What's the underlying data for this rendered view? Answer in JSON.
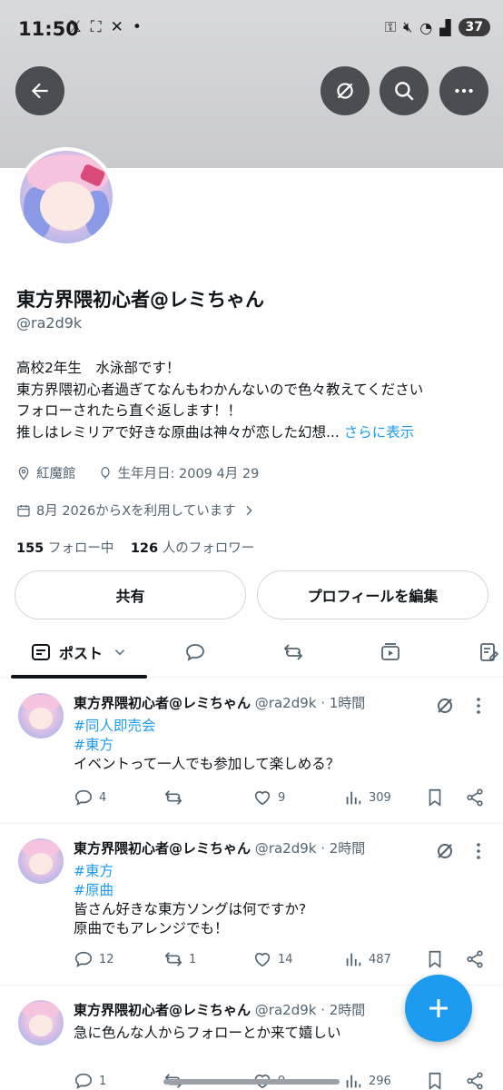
{
  "status_bar": {
    "time": "11:50",
    "battery": "37"
  },
  "profile": {
    "name": "東方界隈初心者@レミちゃん",
    "handle": "@ra2d9k",
    "bio_lines": [
      "高校2年生　水泳部です！",
      "東方界隈初心者過ぎてなんもわかんないので色々教えてください",
      "フォローされたら直ぐ返します！！",
      "推しはレミリアで好きな原曲は神々が恋した幻想..."
    ],
    "bio_more": "さらに表示",
    "location": "紅魔館",
    "birthday": "生年月日: 2009 4月 29",
    "joined": "8月 2026からXを利用しています",
    "following_count": "155",
    "following_label": "フォロー中",
    "followers_count": "126",
    "followers_label": "人のフォロワー",
    "share_button": "共有",
    "edit_button": "プロフィールを編集"
  },
  "tabs": {
    "posts_label": "ポスト"
  },
  "posts": [
    {
      "name": "東方界隈初心者@レミちゃん",
      "meta": "@ra2d9k · 1時間",
      "tags": [
        "#同人即売会",
        "#東方"
      ],
      "text_lines": [
        "イベントって一人でも参加して楽しめる？"
      ],
      "replies": "4",
      "reposts": "",
      "likes": "9",
      "views": "309"
    },
    {
      "name": "東方界隈初心者@レミちゃん",
      "meta": "@ra2d9k · 2時間",
      "tags": [
        "#東方",
        "#原曲"
      ],
      "text_lines": [
        "皆さん好きな東方ソングは何ですか?",
        "原曲でもアレンジでも！"
      ],
      "replies": "12",
      "reposts": "1",
      "likes": "14",
      "views": "487"
    },
    {
      "name": "東方界隈初心者@レミちゃん",
      "meta": "@ra2d9k · 2時間",
      "tags": [],
      "text_lines": [
        "急に色んな人からフォローとか来て嬉しい"
      ],
      "replies": "1",
      "reposts": "",
      "likes": "9",
      "views": "296"
    }
  ]
}
